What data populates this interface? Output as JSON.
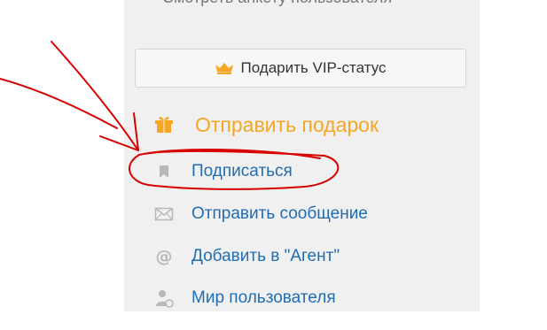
{
  "header": {
    "cut_off_text": "Смотреть анкету пользователя"
  },
  "vip_button": {
    "icon": "crown-icon",
    "label": "Подарить VIP-статус"
  },
  "actions": {
    "gift": {
      "icon": "gift-icon",
      "label": "Отправить подарок"
    },
    "items": [
      {
        "icon": "bookmark-icon",
        "label": "Подписаться"
      },
      {
        "icon": "envelope-icon",
        "label": "Отправить сообщение"
      },
      {
        "icon": "at-sign-icon",
        "label": "Добавить в \"Агент\""
      },
      {
        "icon": "user-world-icon",
        "label": "Мир пользователя"
      }
    ]
  },
  "colors": {
    "panel_background": "#f0f0f0",
    "gift_orange": "#f5a623",
    "link_blue": "#1f6db5",
    "annotation_red": "#d80000",
    "icon_gray": "#b8b8b8"
  }
}
